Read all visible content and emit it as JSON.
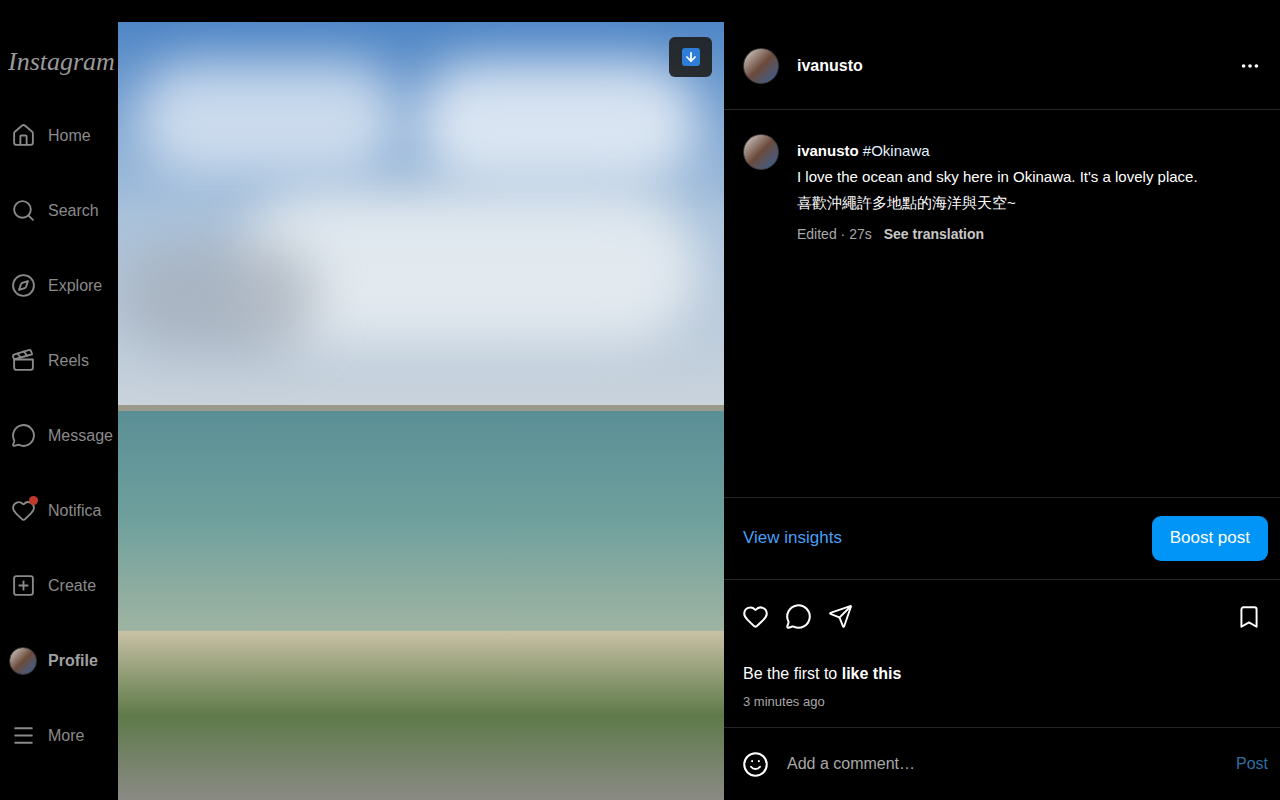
{
  "sidebar": {
    "logo": "Instagram",
    "items": [
      {
        "label": "Home",
        "kind": "icon",
        "selected": false,
        "badge": false
      },
      {
        "label": "Search",
        "kind": "icon",
        "selected": false,
        "badge": false
      },
      {
        "label": "Explore",
        "kind": "icon",
        "selected": false,
        "badge": false
      },
      {
        "label": "Reels",
        "kind": "icon",
        "selected": false,
        "badge": false
      },
      {
        "label": "Message",
        "kind": "icon",
        "selected": false,
        "badge": false
      },
      {
        "label": "Notifica",
        "kind": "icon",
        "selected": false,
        "badge": true
      },
      {
        "label": "Create",
        "kind": "icon",
        "selected": false,
        "badge": false
      },
      {
        "label": "Profile",
        "kind": "avatar",
        "selected": true,
        "badge": false
      },
      {
        "label": "More",
        "kind": "icon",
        "selected": false,
        "badge": false
      }
    ]
  },
  "post": {
    "author": "ivanusto",
    "caption": {
      "author": "ivanusto",
      "hashtag": "#Okinawa",
      "lines": [
        "I love the ocean and sky here in Okinawa. It's a lovely place.",
        "喜歡沖繩許多地點的海洋與天空~"
      ],
      "edited": "Edited · 27s",
      "translate": "See translation"
    },
    "insights": "View insights",
    "boost": "Boost post",
    "liked": false,
    "saved": false,
    "likes": {
      "prefix": "Be the first to ",
      "bold": "like this"
    },
    "time": "3 minutes ago",
    "comment": {
      "placeholder": "Add a comment…",
      "post": "Post",
      "disabled": true
    }
  }
}
